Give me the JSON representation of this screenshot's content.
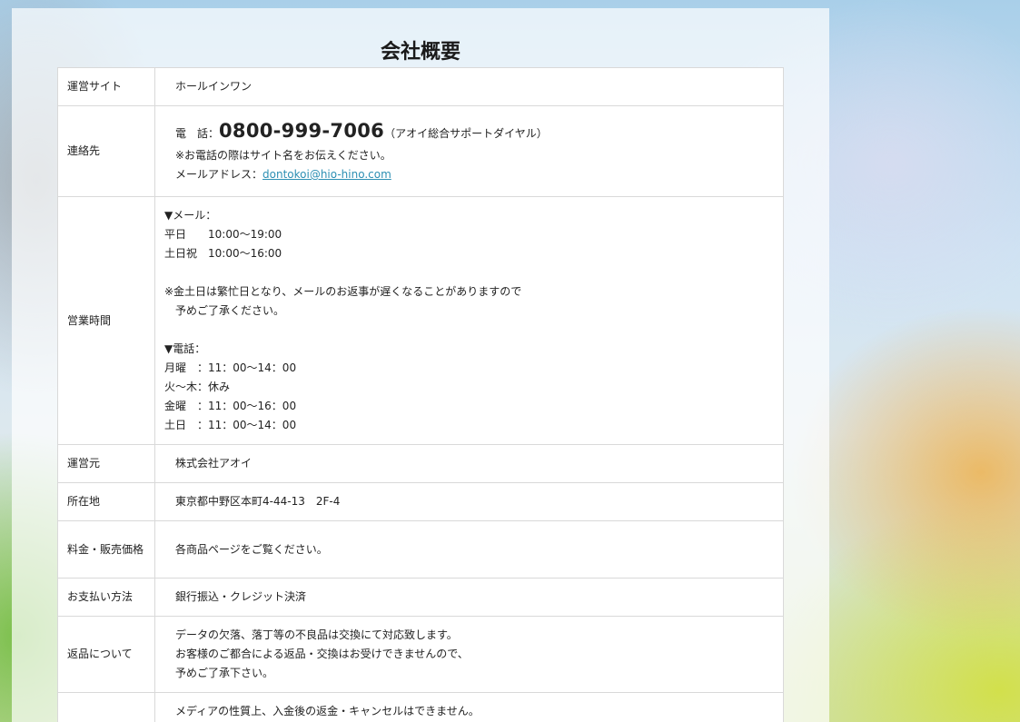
{
  "page_title": "会社概要",
  "rows": {
    "site": {
      "label": "運営サイト",
      "value": "ホールインワン"
    },
    "contact": {
      "label": "連絡先",
      "phone_prefix": "電　話：",
      "phone_number": "0800-999-7006",
      "phone_note": "（アオイ総合サポートダイヤル）",
      "notice": "※お電話の際はサイト名をお伝えください。",
      "email_prefix": "メールアドレス：",
      "email": "dontokoi@hio-hino.com"
    },
    "hours": {
      "label": "営業時間",
      "lines": [
        "▼メール：",
        "平日　　10:00～19:00",
        "土日祝　10:00～16:00",
        "",
        "※金土日は繁忙日となり、メールのお返事が遅くなることがありますので",
        "　予めご了承ください。",
        "",
        "▼電話：",
        "月曜　：11：00～14：00",
        "火～木：休み",
        "金曜　：11：00～16：00",
        "土日　：11：00～14：00"
      ]
    },
    "operator": {
      "label": "運営元",
      "value": "株式会社アオイ"
    },
    "address": {
      "label": "所在地",
      "value": "東京都中野区本町4-44-13　2F-4"
    },
    "pricing": {
      "label": "料金・販売価格",
      "value": "各商品ページをご覧ください。"
    },
    "payment": {
      "label": "お支払い方法",
      "value": "銀行振込・クレジット決済"
    },
    "returns": {
      "label": "返品について",
      "lines": [
        "データの欠落、落丁等の不良品は交換にて対応致します。",
        "お客様のご都合による返品・交換はお受けできませんので、",
        "予めご了承下さい。"
      ]
    },
    "cancel": {
      "label": "",
      "lines": [
        "メディアの性質上、入金後の返金・キャンセルはできません。"
      ]
    }
  }
}
